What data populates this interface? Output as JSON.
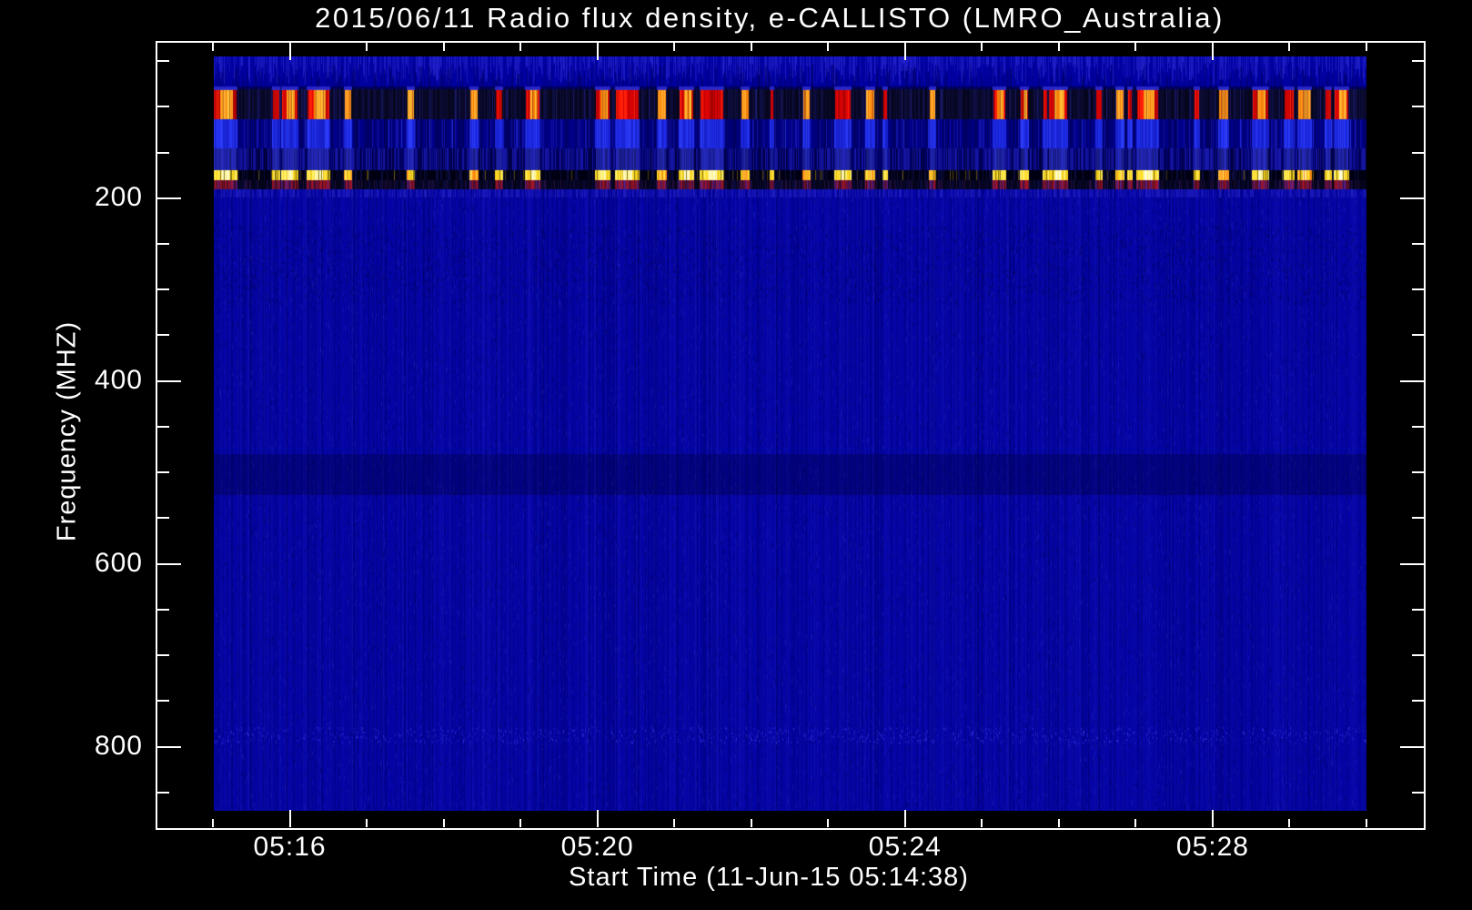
{
  "chart_data": {
    "type": "heatmap",
    "title": "2015/06/11  Radio flux density, e-CALLISTO (LMRO_Australia)",
    "xlabel": "Start Time (11-Jun-15 05:14:38)",
    "ylabel": "Frequency (MHZ)",
    "x_axis": {
      "start_time": "05:15:00",
      "end_time": "05:30:00",
      "total_minutes": 15,
      "minor_step_minutes": 1,
      "major_ticks": [
        {
          "minute": 1,
          "label": "05:16"
        },
        {
          "minute": 5,
          "label": "05:20"
        },
        {
          "minute": 9,
          "label": "05:24"
        },
        {
          "minute": 13,
          "label": "05:28"
        }
      ]
    },
    "y_axis": {
      "range_mhz": [
        45,
        870
      ],
      "major_ticks": [
        200,
        400,
        600,
        800
      ],
      "major_tick_labels": [
        "200",
        "400",
        "600",
        "800"
      ],
      "minor_step_mhz": 50,
      "direction": "increasing-downward"
    },
    "colors": {
      "background": "#000000",
      "frame": "#ffffff",
      "text": "#ffffff",
      "body_blue": "#0404a4",
      "dark_navy": "#06061e",
      "burst_red": "#e00505",
      "burst_orange": "#ff9018",
      "stripe_yellow": "#ffe23a",
      "stripe_maroon": "#8c1228",
      "stripe_purple": "#5a2080",
      "bright_blue": "#1f2ce8"
    },
    "bands": [
      {
        "mhz": [
          45,
          81
        ],
        "kind": "blue-streak-texture"
      },
      {
        "mhz": [
          81,
          114
        ],
        "kind": "rfi-burst-band-red-orange-on-dark"
      },
      {
        "mhz": [
          114,
          146
        ],
        "kind": "bright-blue-columns"
      },
      {
        "mhz": [
          146,
          169
        ],
        "kind": "dense-blue-stripes"
      },
      {
        "mhz": [
          169,
          180
        ],
        "kind": "yellow-stripes-on-black"
      },
      {
        "mhz": [
          180,
          190
        ],
        "kind": "maroon-purple-stripes"
      }
    ],
    "body_features": [
      {
        "mhz": [
          230,
          315
        ],
        "kind": "slightly-darker-speckle"
      },
      {
        "mhz": [
          480,
          525
        ],
        "kind": "darker-band"
      },
      {
        "mhz": [
          778,
          795
        ],
        "kind": "faint-bright-speckle-row"
      }
    ],
    "bursts": [
      {
        "t0": 0,
        "t1": 18,
        "c": "mixed"
      },
      {
        "t0": 46,
        "t1": 51,
        "c": "red"
      },
      {
        "t0": 53,
        "t1": 65,
        "c": "mixed"
      },
      {
        "t0": 73,
        "t1": 90,
        "c": "mixed"
      },
      {
        "t0": 102,
        "t1": 107,
        "c": "orange"
      },
      {
        "t0": 151,
        "t1": 156,
        "c": "orange"
      },
      {
        "t0": 200,
        "t1": 206,
        "c": "orange"
      },
      {
        "t0": 220,
        "t1": 225,
        "c": "red"
      },
      {
        "t0": 244,
        "t1": 254,
        "c": "mixed"
      },
      {
        "t0": 298,
        "t1": 309,
        "c": "mixed"
      },
      {
        "t0": 314,
        "t1": 332,
        "c": "red"
      },
      {
        "t0": 347,
        "t1": 353,
        "c": "orange"
      },
      {
        "t0": 364,
        "t1": 374,
        "c": "mixed"
      },
      {
        "t0": 380,
        "t1": 398,
        "c": "red"
      },
      {
        "t0": 412,
        "t1": 418,
        "c": "orange"
      },
      {
        "t0": 435,
        "t1": 437,
        "c": "red"
      },
      {
        "t0": 460,
        "t1": 465,
        "c": "orange"
      },
      {
        "t0": 485,
        "t1": 497,
        "c": "red"
      },
      {
        "t0": 509,
        "t1": 516,
        "c": "orange"
      },
      {
        "t0": 523,
        "t1": 526,
        "c": "red"
      },
      {
        "t0": 559,
        "t1": 563,
        "c": "orange"
      },
      {
        "t0": 609,
        "t1": 618,
        "c": "mixed"
      },
      {
        "t0": 630,
        "t1": 636,
        "c": "mixed"
      },
      {
        "t0": 648,
        "t1": 651,
        "c": "red"
      },
      {
        "t0": 652,
        "t1": 666,
        "c": "mixed"
      },
      {
        "t0": 689,
        "t1": 693,
        "c": "red"
      },
      {
        "t0": 705,
        "t1": 710,
        "c": "orange"
      },
      {
        "t0": 714,
        "t1": 717,
        "c": "red"
      },
      {
        "t0": 721,
        "t1": 737,
        "c": "mixed"
      },
      {
        "t0": 766,
        "t1": 769,
        "c": "red"
      },
      {
        "t0": 785,
        "t1": 792,
        "c": "orange"
      },
      {
        "t0": 811,
        "t1": 823,
        "c": "mixed"
      },
      {
        "t0": 836,
        "t1": 843,
        "c": "red"
      },
      {
        "t0": 847,
        "t1": 857,
        "c": "orange"
      },
      {
        "t0": 868,
        "t1": 872,
        "c": "red"
      },
      {
        "t0": 875,
        "t1": 886,
        "c": "mixed"
      }
    ]
  }
}
